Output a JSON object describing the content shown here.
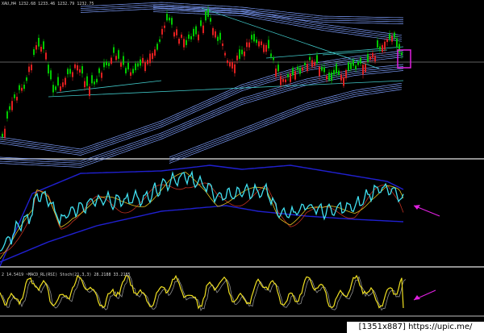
{
  "symbol_info": "XAU,H4  1232.68 1233.46 1232.79 1232.75",
  "indicator2_info": "2  14.5419  ~MACD_RL(RSI)  Stoch(21,3,3)  28.2188  33.2185",
  "watermark": "[1351x887] https://upic.me/",
  "colors": {
    "background": "#000000",
    "candle_up": "#00c800",
    "candle_down": "#e02020",
    "envelope": "#7f9fff",
    "trendline": "#40c8c8",
    "horizontal_line": "#808080",
    "separator": "#c0c0c0",
    "rsi_line": "#40e0f0",
    "band": "#2020d0",
    "ma_red": "#c03020",
    "ma_yellow": "#e0c020",
    "stoch_yellow": "#f0e020",
    "stoch_gray": "#909090",
    "annotation": "#e020e0"
  },
  "chart_data": {
    "type": "line",
    "title": "",
    "symbol": "XAU",
    "timeframe": "H4",
    "last_bar": {
      "open": 1232.68,
      "high": 1233.46,
      "low": 1232.79,
      "close": 1232.75
    },
    "indicator2": {
      "name": "Stoch(21,3,3)",
      "value1": 28.2188,
      "value2": 33.2185,
      "level": 14.5419
    }
  }
}
